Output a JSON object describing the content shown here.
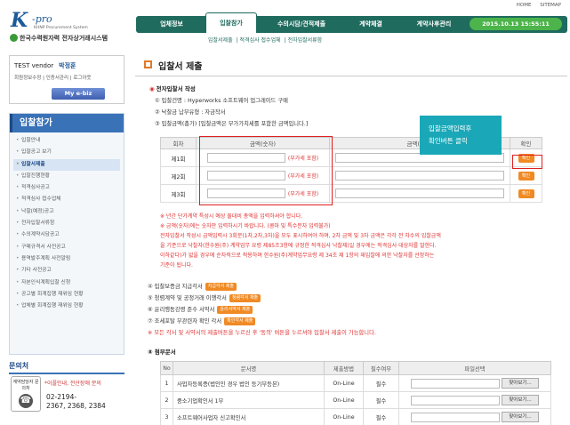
{
  "header": {
    "logo_k": "K",
    "logo_pro": "-pro",
    "logo_sub": "KHNP Procurement System",
    "logo_ko": "한국수력원자력 전자상거래시스템",
    "links": [
      "HOME",
      "SITEMAP"
    ],
    "tabs": [
      "업체정보",
      "입찰참가",
      "수의시담/견적제출",
      "계약체결",
      "계약사후관리"
    ],
    "datetime": "2015.10.13  15:55:11",
    "subnav": [
      "입찰서제출",
      "적격심사 접수업체",
      "전자입찰서류함"
    ]
  },
  "user": {
    "vendor": "TEST vendor",
    "person": "박정훈",
    "links": "회원정보수정 | 인증서관리 | 로그아웃",
    "ebiz": "My e-biz"
  },
  "sidenav": {
    "title": "입찰참가",
    "items": [
      "입찰안내",
      "입찰공고 보기",
      "입찰서제출",
      "입찰진행현황",
      "적격심사공고",
      "적격심사 접수업체",
      "낙찰(예정)공고",
      "전자입찰서류함",
      "수의계약시담공고",
      "구매규격서 사전공고",
      "용역발주계획 사전알림",
      "기타 사전공고",
      "자본인식계획입찰 신청",
      "공고별 회계집행 재위임 현황",
      "업체별 회계집행 재위임 현황"
    ],
    "active_index": 2
  },
  "contact": {
    "title": "문의처",
    "icon_label": "계약담당자 문의처",
    "info": "*이플인내, 전산장애 문의",
    "numbers": "02-2194-\n2367, 2368, 2384"
  },
  "main": {
    "title": "입찰서 제출",
    "section1": "전자입찰서 작성",
    "line1": "① 입찰건명 : Hyperworks 소프트웨어 업그레이드 구매",
    "line2": "② 낙찰금 납부유형 : 자금작서",
    "line3": "③ 입찰금액(총가) [입찰금액은 부가가치세를 포함한 금액입니다.]",
    "table_headers": [
      "회차",
      "금액(숫자)",
      "금액(한글)",
      "확인"
    ],
    "rows": [
      {
        "round": "제1회",
        "vat": "(부가세 포함)",
        "confirm": "확인"
      },
      {
        "round": "제2회",
        "vat": "(부가세 포함)",
        "confirm": "확인"
      },
      {
        "round": "제3회",
        "vat": "(부가세 포함)",
        "confirm": "확인"
      }
    ],
    "tooltip": "입찰금액입력후\n확인버튼 클릭",
    "notes": [
      "※ 년간 단가계약 특성시 예상 물대비 총액을 입력하셔야 합니다.",
      "※ 금액(숫자)에는 숫자만 입력하시기 바랍니다. (콤마 및 특수문자 입력불가)",
      "전자입찰서 작성시 금액입력시 3회분(1차,2차,3차)을 모두 표시하여야 하며, 2차 금액 및 3차 금액은 각각 전 차수의 입찰금액",
      "을 기준으로 낙찰자(한수원(주) 계약업무 요령 제85조3항에 규정한 적격심사 낙찰제)일 경우에는 적격심사 대상자를 말한다.",
      "이하같다)가 없을 경우에 순차적으로 적용하며 한수원(주)계약업무요령 제 34조 제 1항의 재입찰에 의한 낙찰자를 선정하는",
      "기준이 됩니다."
    ],
    "checks": [
      {
        "label": "④ 입찰보증금 지급각서",
        "btn": "지급각서 제출"
      },
      {
        "label": "⑤ 청렴계약 및 공정거래 이행각서",
        "btn": "청렴각서 제출"
      },
      {
        "label": "⑥ 윤리행동강령 준수 서약서",
        "btn": "윤리서약서 제출"
      },
      {
        "label": "⑦ 조세포탈 무관련자 확인 각서",
        "btn": "확인각서 제출"
      }
    ],
    "checks_warn": "※ 모든 각서 및 서약서의 제출버튼을 누르신 후 '동의' 버튼을 누르셔야 입찰서 제출이 가능합니다.",
    "section2": "⑧ 첨부문서",
    "doc_headers": [
      "No",
      "문서명",
      "제출방법",
      "필수여부",
      "파일선택"
    ],
    "docs": [
      {
        "no": "1",
        "name": "사업자등록증(법인인 경우 법인 등기부등본)",
        "method": "On-Line",
        "req": "필수",
        "btn": "찾아보기..."
      },
      {
        "no": "2",
        "name": "중소기업확인서 1부",
        "method": "On-Line",
        "req": "필수",
        "btn": "찾아보기..."
      },
      {
        "no": "3",
        "name": "소프트웨어사업자 신고확인서",
        "method": "On-Line",
        "req": "필수",
        "btn": "찾아보기..."
      }
    ]
  }
}
